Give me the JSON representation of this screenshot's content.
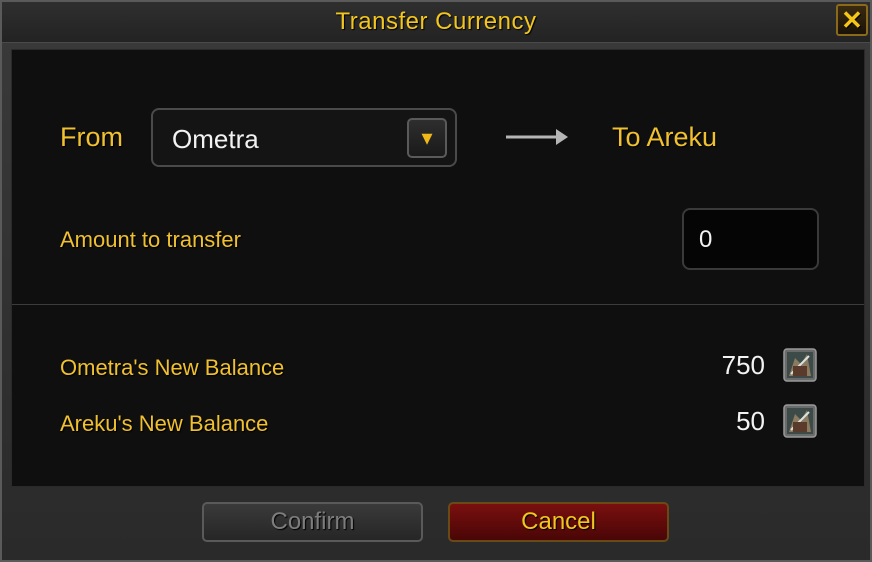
{
  "window": {
    "title": "Transfer Currency",
    "close_glyph": "✕"
  },
  "transfer": {
    "from_label": "From",
    "from_selected": "Ometra",
    "dropdown_glyph": "▾",
    "to_label": "To Areku",
    "amount_label": "Amount to transfer",
    "amount_value": "0"
  },
  "balances": [
    {
      "label": "Ometra's New Balance",
      "value": "750",
      "icon": "currency-icon"
    },
    {
      "label": "Areku's New Balance",
      "value": "50",
      "icon": "currency-icon"
    }
  ],
  "buttons": {
    "confirm_label": "Confirm",
    "cancel_label": "Cancel"
  },
  "colors": {
    "accent_gold": "#f0c030",
    "cancel_red": "#7a0f0f",
    "panel_bg": "#0f0f10"
  }
}
